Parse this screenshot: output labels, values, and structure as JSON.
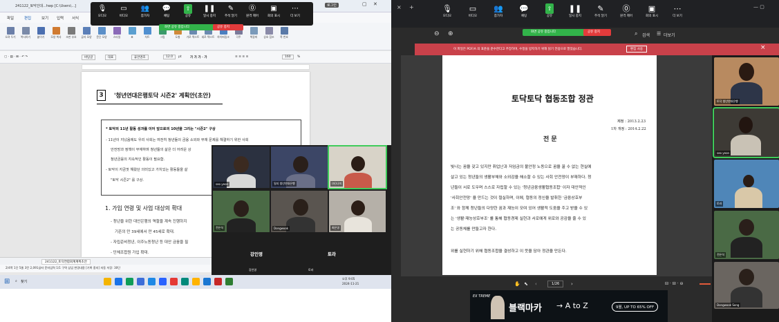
{
  "left": {
    "window_title": "241122_토닥인대...hwp [C:\\Users\\...]",
    "title_right_label": "로그인",
    "menu": [
      "파일",
      "편집",
      "보기",
      "입력",
      "서식"
    ],
    "ribbon_items": [
      "오려 두기",
      "복사하기",
      "붙이기",
      "모양 복사",
      "조판 부호",
      "글자 모양",
      "문단 모양",
      "스타일",
      "표",
      "차트",
      "그림",
      "도형",
      "가로 텍스트",
      "세로 텍스트",
      "하이퍼링크",
      "각주",
      "책갈피",
      "상호 참조",
      "쪽 번호"
    ],
    "format_bar": {
      "style": "바탕글",
      "font_type": "대표",
      "font": "휴먼명조",
      "size": "12.0",
      "unit": "pt",
      "spacing": "160",
      "percent": "%"
    },
    "zoom_controls": [
      {
        "icon": "mic-icon",
        "label": "오디오"
      },
      {
        "icon": "video-icon",
        "label": "비디오"
      },
      {
        "icon": "participants-icon",
        "label": "참가자",
        "count": "8"
      },
      {
        "icon": "chat-icon",
        "label": "채팅"
      },
      {
        "icon": "share-icon",
        "label": "공유"
      },
      {
        "icon": "pause-icon",
        "label": "일시 중지"
      },
      {
        "icon": "annotate-icon",
        "label": "주석 달기"
      },
      {
        "icon": "remote-icon",
        "label": "원격 제어"
      },
      {
        "icon": "apps-icon",
        "label": "회의 표시"
      },
      {
        "icon": "more-icon",
        "label": "더 보기"
      }
    ],
    "share_banner": "화면 공유 중입니다",
    "stop_share": "공유 중지",
    "section_number": "3",
    "section_title": "'청년연대은행토닥 시즌2' 계획안(초안)",
    "box_lines": [
      "* 토닥의 11년 활동 성과를 이어 앞으로의 10년을 그리는 \"시즌2\" 구상",
      "- 11년이 지났음에도 우리 사회는 여전히 청년들의 금융 소외와 부채 문제를 해결하기 위한 사회",
      "안전망과 정책이 부재하며 청년들의 삶은 더 어려운 상",
      "청년금융의 지속적인 활동이 필요함.",
      "- 토닥이 지금껏 해왔던 의미있고 가치있는 활동들을 살",
      "\"토닥 시즌2\" 를 구상."
    ],
    "heading1": "1. 가입 연령 및 사업 대상의 확대",
    "body_lines": [
      "- 청년을 위한 대안은행의 역할을 계속 진행하지",
      "기존의 만 39세에서 만 45세로 확대.",
      "- 자립준비청년, 이주노동청년 등 대안 금융을 필",
      "- 단체조합원 가입 확대."
    ],
    "status_tab": "241122_토닥연합회계계획초안",
    "status_info": "2/4쪽  1단  5줄  3칸  2,091글자  문자입력  1/1 구역  삽입  변경내용 [기록 중지]  자동 저장: 30단",
    "taskbar_search": "찾기",
    "taskbar_time": "오후 9:05",
    "taskbar_date": "2024-11-21",
    "gallery": [
      {
        "name": "seo yeon"
      },
      {
        "name": "일지 청년연대은행"
      },
      {
        "name": "(좌)나미"
      },
      {
        "name": "전은석"
      },
      {
        "name": "Dongwook"
      },
      {
        "name": "최은영"
      }
    ],
    "gallery_names": [
      "강인영",
      "토라"
    ],
    "gallery_subs": [
      "강인영",
      "토라"
    ]
  },
  "right": {
    "zoom_controls": [
      {
        "icon": "mic-icon",
        "label": "오디오"
      },
      {
        "icon": "video-icon",
        "label": "비디오"
      },
      {
        "icon": "participants-icon",
        "label": "참가자",
        "count": "8"
      },
      {
        "icon": "chat-icon",
        "label": "채팅"
      },
      {
        "icon": "share-icon",
        "label": "공유"
      },
      {
        "icon": "pause-icon",
        "label": "일시 중지"
      },
      {
        "icon": "annotate-icon",
        "label": "주석 달기"
      },
      {
        "icon": "remote-icon",
        "label": "원격 제어"
      },
      {
        "icon": "apps-icon",
        "label": "회의 표시"
      },
      {
        "icon": "more-icon",
        "label": "더 보기"
      }
    ],
    "share_banner": "화면 공유 중입니다",
    "stop_share": "공유 중지",
    "search_label": "검색",
    "more_label": "더보기",
    "red_banner": "이 파일은 PDF/A 의 표준을 준수한다고 주장하며, 수정을 방지하기 위해 읽기 전용으로 열었습니다.",
    "red_banner_button": "편집 사용",
    "doc_title": "토닥토닥 협동조합 정관",
    "date1": "제정 : 2013.2.23",
    "date2": "1차 개정 : 2014.2.22",
    "preamble": "전 문",
    "para1": [
      "빛나는 꿈을 갖고 있지만 취업난과 저임금의 불안정 노동으로 꿈을 꿀 수 없는 현실에",
      "살고 있는 청년들의 생활부채와 소외감을 해소할 수 있는 사회 안전망이 부재하다. 청",
      "년들이 서로 도우며 스스로 자립할 수 있는 '청년금융생활협동조합' 이자 대안적인",
      "'사회안전망' 을 만드는 것이 절실하며, 이에, 협동의 정신을 발휘한 '금융상호부",
      "조' 와 함께 청년들의 다양한 꿈과 재능이 모여 있어 생활적 도움을 주고 받을 수 있",
      "는 '생활·재능상호부조' 를 통해 협동경제 실현과 서로에게 위로와 공감을 줄 수 있",
      "는 공동체를 만들고자 한다."
    ],
    "para2": "위를 실현하기 위해 협동조합을 결성하고 이 뜻을 담아 정관을 만든다.",
    "page_indicator": "1/26",
    "ad_brand": "블랙마카",
    "ad_arrow": "→ A to Z",
    "ad_button": "9월, UP TO 65% OFF",
    "side_tiles": [
      {
        "name": "토닥 청년연대은행"
      },
      {
        "name": "seo yeon"
      },
      {
        "name": "토라"
      },
      {
        "name": "전은석"
      },
      {
        "name": "Dongwook Song"
      }
    ]
  }
}
